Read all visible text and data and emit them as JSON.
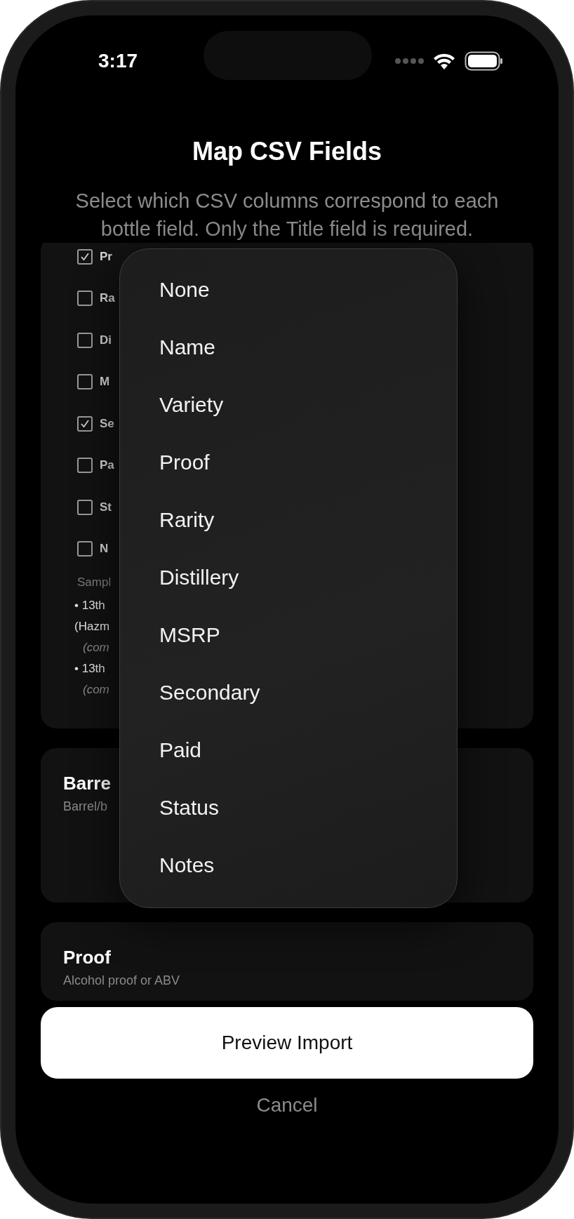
{
  "status_bar": {
    "time": "3:17"
  },
  "title": "Map CSV Fields",
  "subtitle": [
    "Select which CSV columns correspond to each",
    "bottle field. Only the Title field is required."
  ],
  "mapping_card": {
    "rows": [
      {
        "label": "Pr",
        "checked": true
      },
      {
        "label": "Ra",
        "checked": false
      },
      {
        "label": "Di",
        "checked": false
      },
      {
        "label": "M",
        "checked": false
      },
      {
        "label": "Se",
        "checked": true
      },
      {
        "label": "Pa",
        "checked": false
      },
      {
        "label": "St",
        "checked": false
      },
      {
        "label": "N",
        "checked": false
      }
    ],
    "sample_label": "Sampl",
    "samples": [
      {
        "kind": "bullet",
        "text": "• 13th"
      },
      {
        "kind": "line",
        "text": "(Hazm"
      },
      {
        "kind": "note",
        "text": "(com"
      },
      {
        "kind": "bullet",
        "text": "• 13th"
      },
      {
        "kind": "note",
        "text": "(com"
      }
    ]
  },
  "field_cards": [
    {
      "title": "Barre",
      "description": "Barrel/b"
    },
    {
      "title": "Proof",
      "description": "Alcohol proof or ABV"
    }
  ],
  "menu": {
    "items": [
      "None",
      "Name",
      "Variety",
      "Proof",
      "Rarity",
      "Distillery",
      "MSRP",
      "Secondary",
      "Paid",
      "Status",
      "Notes"
    ]
  },
  "primary_button": "Preview Import",
  "cancel_button": "Cancel"
}
